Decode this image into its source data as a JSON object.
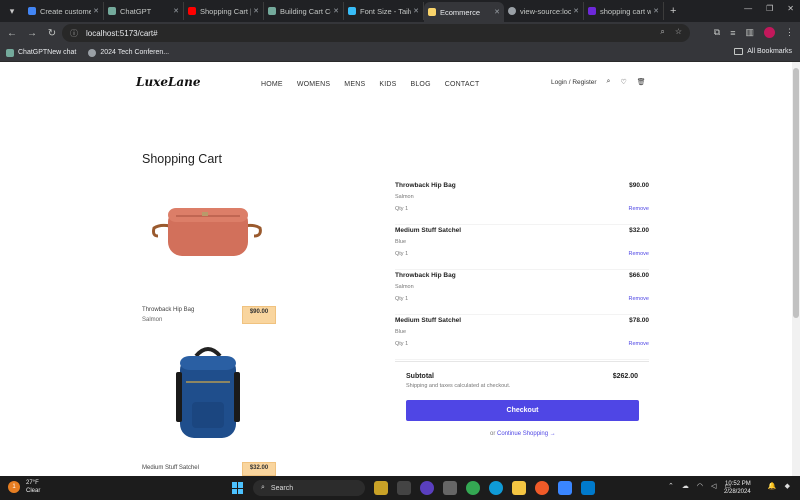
{
  "browser": {
    "tabs": [
      {
        "label": "Create customer",
        "color": "#4285f4",
        "active": false
      },
      {
        "label": "ChatGPT",
        "color": "#74aa9c",
        "active": false
      },
      {
        "label": "Shopping Cart |",
        "color": "#ff0000",
        "active": false
      },
      {
        "label": "Building Cart Co",
        "color": "#74aa9c",
        "active": false
      },
      {
        "label": "Font Size - Tailw",
        "color": "#38bdf8",
        "active": false
      },
      {
        "label": "Ecommerce",
        "color": "#f9d46b",
        "active": true
      },
      {
        "label": "view-source:loca",
        "color": "#9aa0a6",
        "active": false
      },
      {
        "label": "shopping cart w",
        "color": "#6d28d9",
        "active": false
      }
    ],
    "url": "localhost:5173/cart#",
    "bookmarks": [
      {
        "label": "ChatGPTNew chat"
      },
      {
        "label": "2024 Tech Conferen..."
      }
    ],
    "all_bookmarks": "All Bookmarks"
  },
  "site": {
    "logo": "LuxeLane",
    "nav": [
      "HOME",
      "WOMENS",
      "MENS",
      "KIDS",
      "BLOG",
      "CONTACT"
    ],
    "login": "Login / Register"
  },
  "cart": {
    "title": "Shopping Cart",
    "gallery": [
      {
        "name": "Throwback Hip Bag",
        "color": "Salmon",
        "price": "$90.00"
      },
      {
        "name": "Medium Stuff Satchel",
        "color": "",
        "price": "$32.00"
      }
    ],
    "items": [
      {
        "name": "Throwback Hip Bag",
        "price": "$90.00",
        "color": "Salmon",
        "qty": "Qty 1",
        "remove": "Remove"
      },
      {
        "name": "Medium Stuff Satchel",
        "price": "$32.00",
        "color": "Blue",
        "qty": "Qty 1",
        "remove": "Remove"
      },
      {
        "name": "Throwback Hip Bag",
        "price": "$66.00",
        "color": "Salmon",
        "qty": "Qty 1",
        "remove": "Remove"
      },
      {
        "name": "Medium Stuff Satchel",
        "price": "$78.00",
        "color": "Blue",
        "qty": "Qty 1",
        "remove": "Remove"
      }
    ],
    "subtotal_label": "Subtotal",
    "subtotal_value": "$262.00",
    "shipping_note": "Shipping and taxes calculated at checkout.",
    "checkout_label": "Checkout",
    "continue_prefix": "or",
    "continue_link": "Continue Shopping →"
  },
  "taskbar": {
    "weather_badge": "1",
    "temp": "27°F",
    "condition": "Clear",
    "search": "Search",
    "time": "10:52 PM",
    "date": "2/28/2024"
  },
  "colors": {
    "accent": "#4f46e5",
    "price_chip": "#f9d59e"
  }
}
